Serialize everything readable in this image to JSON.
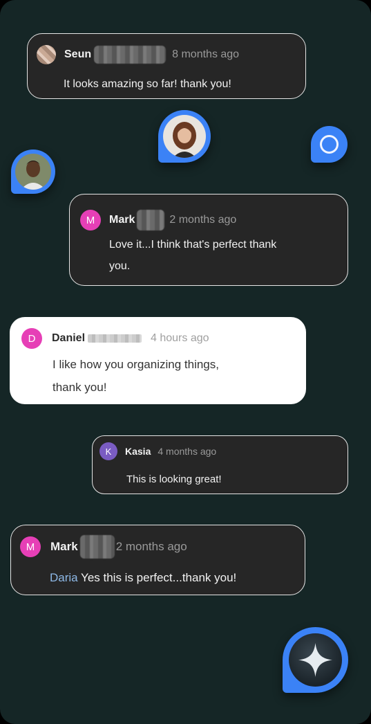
{
  "comments": [
    {
      "author": "Seun",
      "time": "8 months ago",
      "text": "It looks amazing so far! thank you!"
    },
    {
      "avatar_initial": "M",
      "author": "Mark",
      "time": "2 months ago",
      "text_line1": "Love it...I think that's perfect thank",
      "text_line2": "you."
    },
    {
      "avatar_initial": "D",
      "author": "Daniel",
      "time": "4 hours ago",
      "text_line1": "I like how you organizing things,",
      "text_line2": "thank you!"
    },
    {
      "avatar_initial": "K",
      "author": "Kasia",
      "time": "4 months ago",
      "text": "This is looking great!"
    },
    {
      "avatar_initial": "M",
      "author": "Mark",
      "time": "2 months ago",
      "mention": "Daria",
      "text": "Yes this is perfect...thank you!"
    }
  ],
  "colors": {
    "background": "#152626",
    "pin_blue": "#3b82f6",
    "avatar_pink": "#e63fb6",
    "avatar_purple": "#7a5cc2",
    "mention": "#8db8e6"
  }
}
